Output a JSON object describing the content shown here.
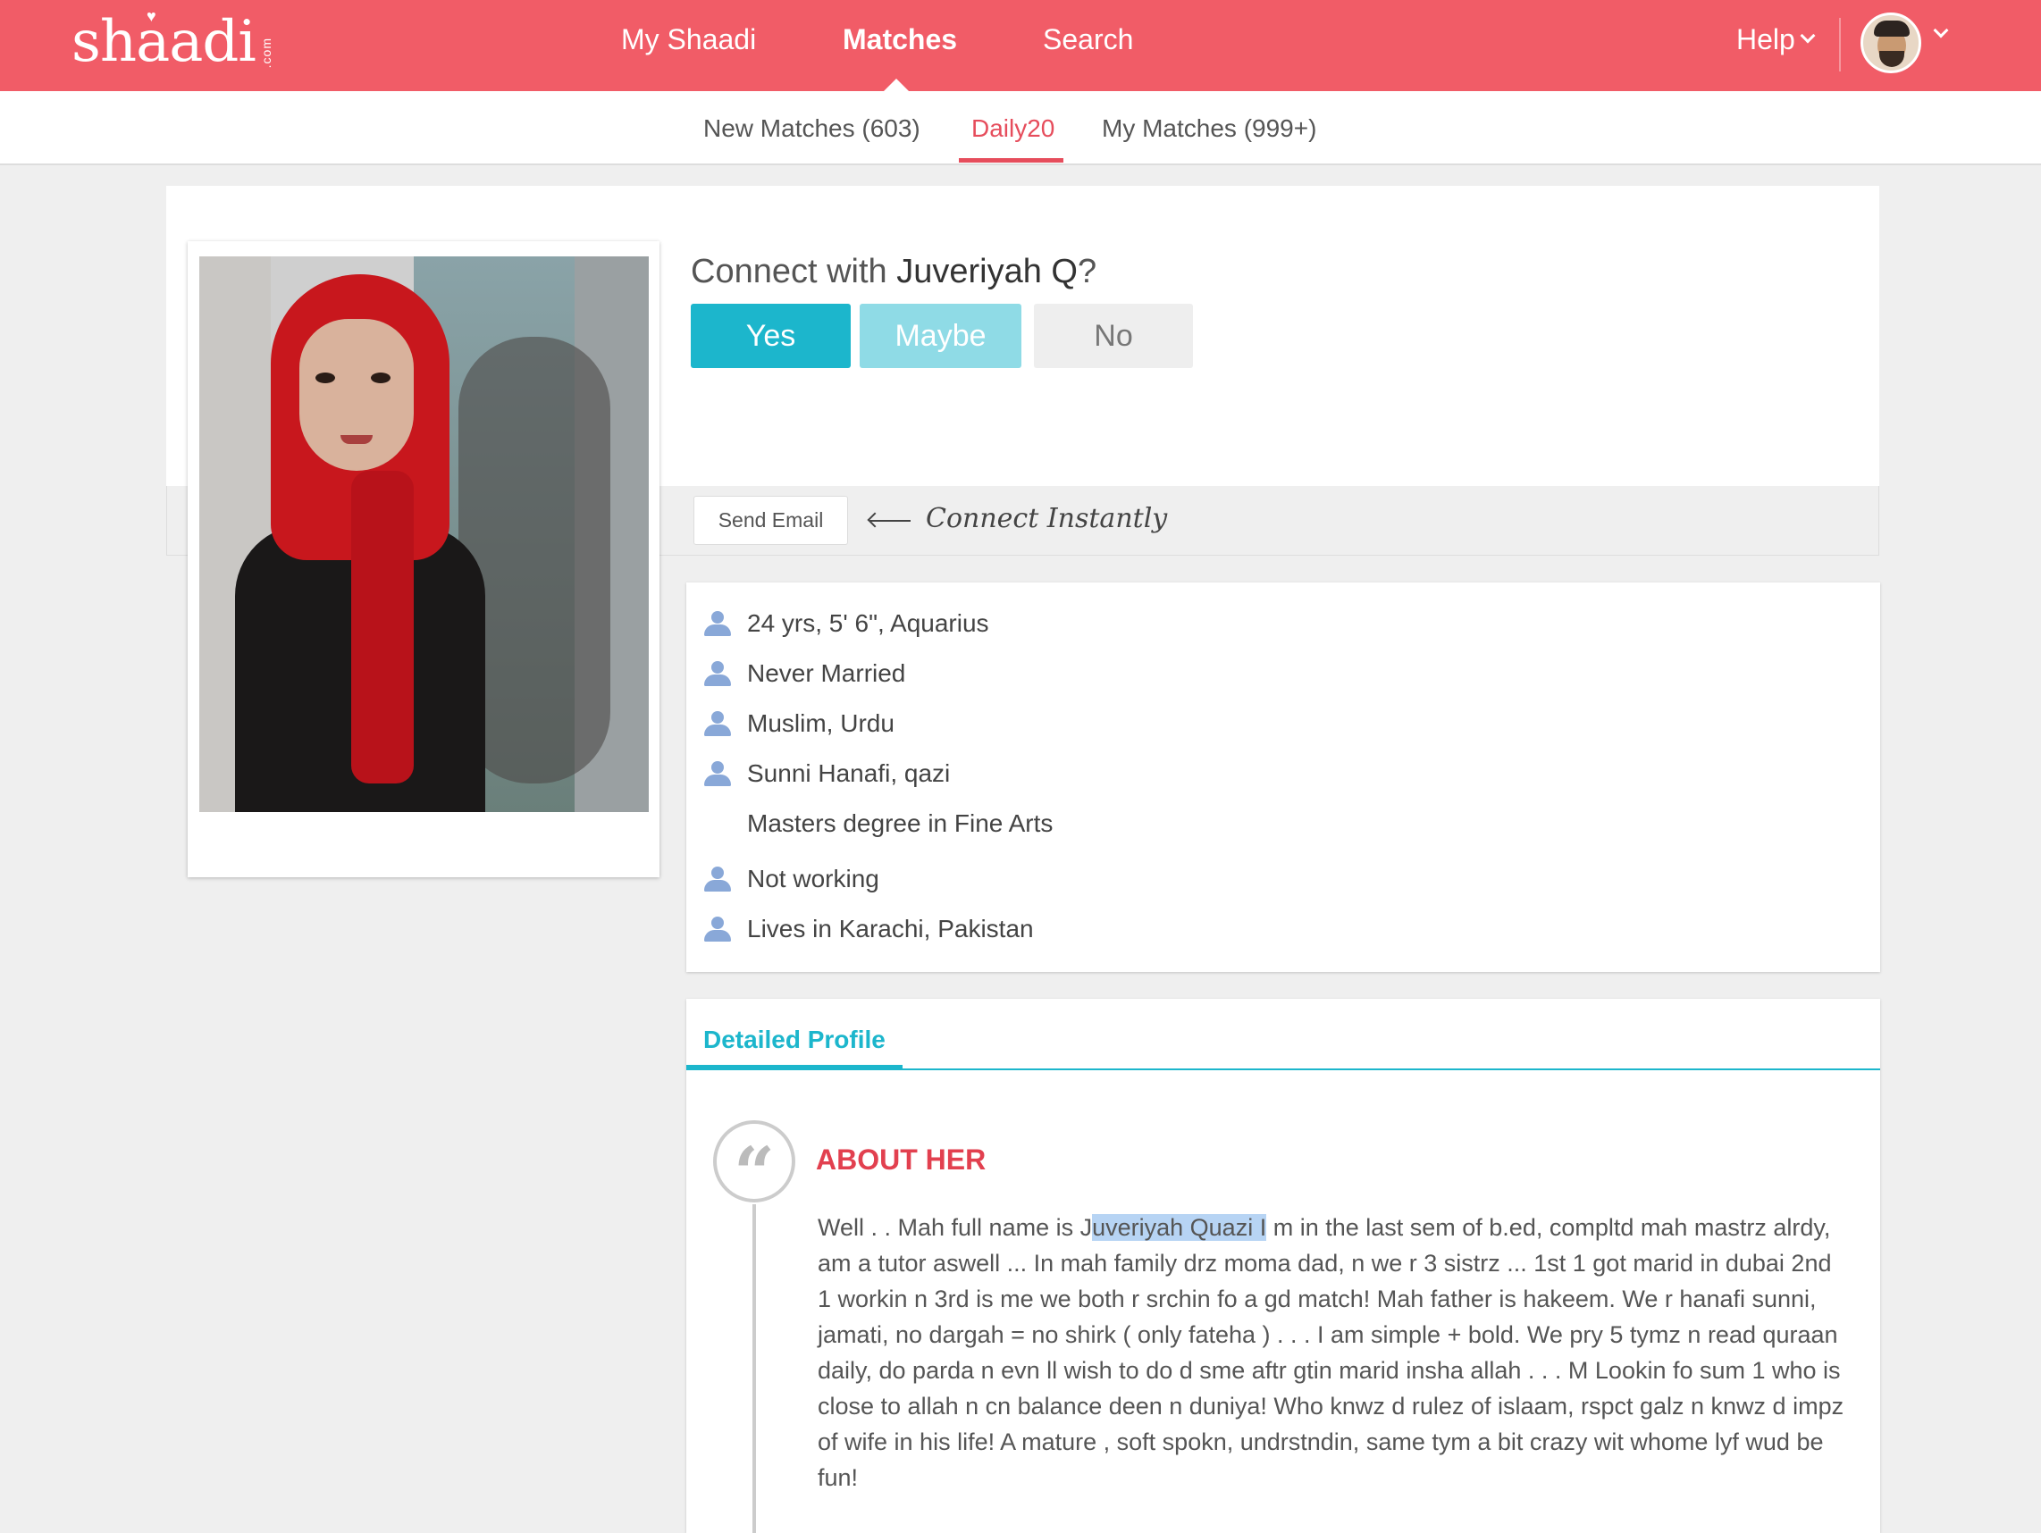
{
  "brand": {
    "logo": "shaadi",
    "logo_suffix": ".com"
  },
  "main_nav": [
    {
      "label": "My Shaadi"
    },
    {
      "label": "Matches"
    },
    {
      "label": "Search"
    }
  ],
  "header": {
    "help_label": "Help"
  },
  "sub_nav": [
    {
      "label": "New Matches (603)"
    },
    {
      "label": "Daily20"
    },
    {
      "label": "My Matches (999+)"
    }
  ],
  "connect": {
    "prefix": "Connect with ",
    "name": "Juveriyah Q",
    "suffix": "?",
    "yes": "Yes",
    "maybe": "Maybe",
    "no": "No",
    "send_email": "Send Email",
    "connect_instantly": "Connect Instantly"
  },
  "info": [
    {
      "text": "24 yrs, 5' 6\", Aquarius",
      "icon": "person-icon"
    },
    {
      "text": "Never Married",
      "icon": "person-icon"
    },
    {
      "text": "Muslim, Urdu",
      "icon": "person-icon"
    },
    {
      "text": "Sunni Hanafi, qazi",
      "icon": "person-icon"
    },
    {
      "text": "Masters degree in Fine Arts",
      "icon": ""
    },
    {
      "text": "Not working",
      "icon": "person-icon"
    },
    {
      "text": "Lives in Karachi, Pakistan",
      "icon": "person-icon"
    }
  ],
  "detail": {
    "tab_label": "Detailed Profile",
    "about_title": "ABOUT HER",
    "about_pre": "Well . . Mah full name is J",
    "about_highlight": "uveriyah Quazi I",
    "about_post": " m in the last sem of b.ed, compltd mah mastrz alrdy, am a tutor aswell ... In mah family drz moma dad, n we r 3 sistrz ... 1st 1 got marid in dubai 2nd 1 workin n 3rd is me we both r srchin fo a gd match! Mah father is hakeem. We r hanafi sunni, jamati, no dargah = no shirk ( only fateha ) . . . I am simple + bold. We pry 5 tymz n read quraan daily, do parda n evn ll wish to do d sme aftr gtin marid insha allah . . . M Lookin fo sum 1 who is close to allah n cn balance deen n duniya! Who knwz d rulez of islaam, rspct galz n knwz d impz of wife in his life! A mature , soft spokn, undrstndin, same tym a bit crazy wit whome lyf wud be fun!"
  },
  "colors": {
    "brand_red": "#f15c67",
    "accent_teal": "#1cb6cc",
    "active_tab": "#e64d5c",
    "about_title": "#e2404f"
  }
}
